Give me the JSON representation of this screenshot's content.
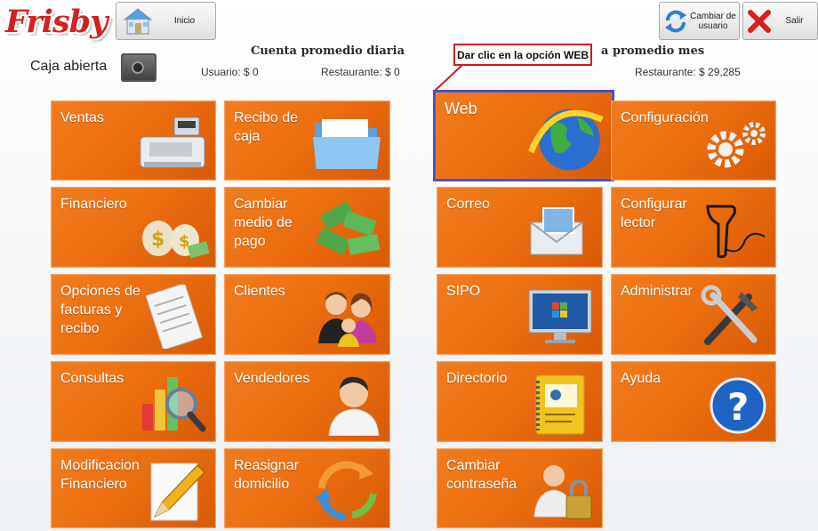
{
  "header": {
    "logo_text": "Frisby",
    "inicio_label": "Inicio",
    "cambiar_usuario_label": "Cambiar de\nusuario",
    "salir_label": "Salir"
  },
  "status": {
    "caja_label": "Caja abierta"
  },
  "stats": {
    "daily_title": "Cuenta promedio diaria",
    "usuario_label": "Usuario: $ 0",
    "restaurante_daily_label": "Restaurante: $ 0",
    "monthly_title": "a promedio mes",
    "restaurante_monthly_label": "Restaurante: $ 29,285"
  },
  "callout": {
    "text": "Dar clic en la opción WEB"
  },
  "tiles": [
    {
      "label": "Ventas",
      "icon": "cash-register-icon"
    },
    {
      "label": "Recibo de\ncaja",
      "icon": "folder-icon"
    },
    {
      "label": "Web",
      "icon": "globe-icon"
    },
    {
      "label": "Configuración",
      "icon": "gears-icon"
    },
    {
      "label": "Financiero",
      "icon": "money-bags-icon"
    },
    {
      "label": "Cambiar\nmedio de\npago",
      "icon": "cash-stacks-icon"
    },
    {
      "label": "Correo",
      "icon": "envelope-icon"
    },
    {
      "label": "Configurar\nlector",
      "icon": "barcode-scanner-icon"
    },
    {
      "label": "Opciones de\nfacturas y\nrecibo",
      "icon": "invoice-icon"
    },
    {
      "label": "Clientes",
      "icon": "people-icon"
    },
    {
      "label": "SIPO",
      "icon": "monitor-icon"
    },
    {
      "label": "Administrar",
      "icon": "tools-icon"
    },
    {
      "label": "Consultas",
      "icon": "chart-magnifier-icon"
    },
    {
      "label": "Vendedores",
      "icon": "person-icon"
    },
    {
      "label": "Directorio",
      "icon": "address-book-icon"
    },
    {
      "label": "Ayuda",
      "icon": "help-icon"
    },
    {
      "label": "Modificacion\nFinanciero",
      "icon": "pencil-paper-icon"
    },
    {
      "label": "Reasignar\ndomicilio",
      "icon": "refresh-arrows-icon"
    },
    {
      "label": "Cambiar\ncontraseña",
      "icon": "user-lock-icon"
    }
  ]
}
